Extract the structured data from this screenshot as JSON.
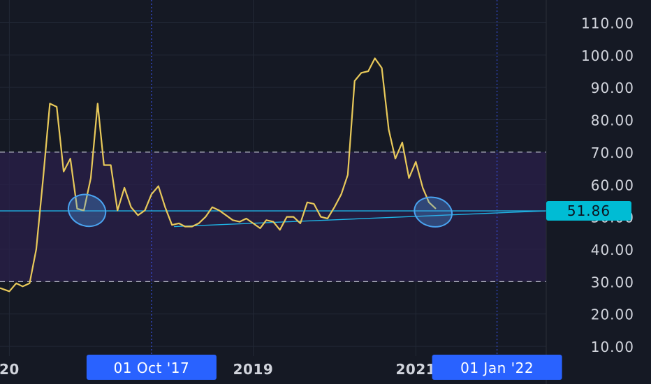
{
  "chart_data": {
    "type": "line",
    "title": "",
    "xlabel": "",
    "ylabel": "",
    "ylim": [
      7,
      117
    ],
    "y_ticks": [
      "110.00",
      "100.00",
      "90.00",
      "80.00",
      "70.00",
      "60.00",
      "50.00",
      "40.00",
      "30.00",
      "20.00",
      "10.00"
    ],
    "y_tick_values": [
      110,
      100,
      90,
      80,
      70,
      60,
      50,
      40,
      30,
      20,
      10
    ],
    "x_labels": [
      "20",
      "2019",
      "2021"
    ],
    "x_label_dates": [
      "2016-01-01",
      "2019-01-01",
      "2021-01-01"
    ],
    "x_range": [
      "2015-11-20",
      "2022-08-10"
    ],
    "grid": true,
    "band": {
      "low": 30,
      "high": 70,
      "color": "#2a1f4a"
    },
    "dashed_levels": [
      70,
      30
    ],
    "last_value": "51.86",
    "last_value_num": 51.86,
    "crosshairs": [
      {
        "label": "01 Oct '17",
        "date": "2017-10-01"
      },
      {
        "label": "01 Jan '22",
        "date": "2022-01-01"
      }
    ],
    "series": [
      {
        "color": "#e8c95a",
        "points": [
          [
            "2015-11-20",
            28
          ],
          [
            "2016-01-01",
            27
          ],
          [
            "2016-02-01",
            29.5
          ],
          [
            "2016-03-01",
            28.5
          ],
          [
            "2016-04-01",
            29.5
          ],
          [
            "2016-05-01",
            40
          ],
          [
            "2016-06-01",
            62
          ],
          [
            "2016-07-01",
            85
          ],
          [
            "2016-08-01",
            84
          ],
          [
            "2016-09-01",
            64
          ],
          [
            "2016-10-01",
            68
          ],
          [
            "2016-11-01",
            52.5
          ],
          [
            "2016-12-01",
            52
          ],
          [
            "2017-01-01",
            62
          ],
          [
            "2017-02-01",
            85
          ],
          [
            "2017-03-01",
            66
          ],
          [
            "2017-04-01",
            66
          ],
          [
            "2017-05-01",
            52
          ],
          [
            "2017-06-01",
            59
          ],
          [
            "2017-07-01",
            53
          ],
          [
            "2017-08-01",
            50.5
          ],
          [
            "2017-09-01",
            52
          ],
          [
            "2017-10-01",
            57
          ],
          [
            "2017-11-01",
            59.5
          ],
          [
            "2017-12-01",
            53
          ],
          [
            "2018-01-01",
            47.5
          ],
          [
            "2018-02-01",
            48
          ],
          [
            "2018-03-01",
            47
          ],
          [
            "2018-04-01",
            47
          ],
          [
            "2018-05-01",
            48
          ],
          [
            "2018-06-01",
            50
          ],
          [
            "2018-07-01",
            53
          ],
          [
            "2018-08-01",
            52
          ],
          [
            "2018-09-01",
            50.5
          ],
          [
            "2018-10-01",
            49
          ],
          [
            "2018-11-01",
            48.5
          ],
          [
            "2018-12-01",
            49.5
          ],
          [
            "2019-01-01",
            48
          ],
          [
            "2019-02-01",
            46.5
          ],
          [
            "2019-03-01",
            49
          ],
          [
            "2019-04-01",
            48.5
          ],
          [
            "2019-05-01",
            46
          ],
          [
            "2019-06-01",
            50
          ],
          [
            "2019-07-01",
            50
          ],
          [
            "2019-08-01",
            48
          ],
          [
            "2019-09-01",
            54.5
          ],
          [
            "2019-10-01",
            54
          ],
          [
            "2019-11-01",
            50
          ],
          [
            "2019-12-01",
            49.5
          ],
          [
            "2020-01-01",
            53
          ],
          [
            "2020-02-01",
            57
          ],
          [
            "2020-03-01",
            63
          ],
          [
            "2020-04-01",
            92
          ],
          [
            "2020-05-01",
            94.5
          ],
          [
            "2020-06-01",
            95
          ],
          [
            "2020-07-01",
            99
          ],
          [
            "2020-08-01",
            96
          ],
          [
            "2020-09-01",
            77
          ],
          [
            "2020-10-01",
            68
          ],
          [
            "2020-11-01",
            73
          ],
          [
            "2020-12-01",
            62
          ],
          [
            "2021-01-01",
            67
          ],
          [
            "2021-02-01",
            59
          ],
          [
            "2021-03-01",
            54.5
          ],
          [
            "2021-04-01",
            52.5
          ]
        ]
      }
    ],
    "trendlines": [
      {
        "color": "#1fb5e6",
        "from": [
          "2015-11-20",
          51.86
        ],
        "to": [
          "2022-08-10",
          51.86
        ]
      },
      {
        "color": "#1fb5e6",
        "from": [
          "2018-01-10",
          47
        ],
        "to": [
          "2022-08-10",
          51.86
        ]
      }
    ],
    "ellipses": [
      {
        "color": "#4aa3f0",
        "cx_date": "2016-12-15",
        "cy": 52,
        "rx_days": 85,
        "ry": 4.8,
        "angle": 18
      },
      {
        "color": "#4aa3f0",
        "cx_date": "2021-03-20",
        "cy": 51.5,
        "rx_days": 85,
        "ry": 4.5,
        "angle": 12
      }
    ],
    "colors": {
      "background": "#151924",
      "grid": "#222836",
      "axis_text": "#d1d4dc",
      "label_bg": "#2962ff",
      "last_value_bg": "#00bcd4",
      "crosshair": "#3d5afe"
    }
  }
}
